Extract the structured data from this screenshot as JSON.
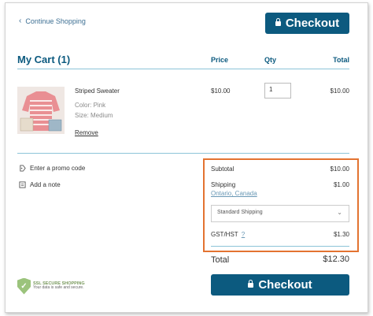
{
  "header": {
    "continue_label": "Continue Shopping",
    "checkout_label": "Checkout"
  },
  "cart": {
    "title": "My Cart (1)",
    "columns": {
      "price": "Price",
      "qty": "Qty",
      "total": "Total"
    }
  },
  "item": {
    "name": "Striped Sweater",
    "color": "Color: Pink",
    "size": "Size: Medium",
    "price": "$10.00",
    "qty": "1",
    "total": "$10.00",
    "remove_label": "Remove"
  },
  "actions": {
    "promo_label": "Enter a promo code",
    "note_label": "Add a note"
  },
  "summary": {
    "subtotal_label": "Subtotal",
    "subtotal_value": "$10.00",
    "shipping_label": "Shipping",
    "shipping_value": "$1.00",
    "shipping_location": "Ontario, Canada",
    "shipping_method": "Standard Shipping",
    "tax_label": "GST/HST",
    "tax_info": "?",
    "tax_value": "$1.30",
    "total_label": "Total",
    "total_value": "$12.30"
  },
  "footer": {
    "checkout_label": "Checkout",
    "ssl_line1": "SSL SECURE SHOPPING",
    "ssl_line2": "Your data is safe and secure."
  },
  "colors": {
    "brand": "#0c5a7f",
    "highlight_border": "#e37331",
    "rule": "#8cc4d8"
  }
}
